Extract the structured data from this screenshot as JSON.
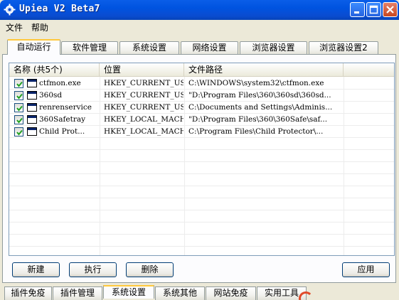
{
  "window": {
    "title": "Upiea V2 Beta7"
  },
  "menu": {
    "items": [
      "文件",
      "帮助"
    ]
  },
  "tabs_top": [
    "自动运行",
    "软件管理",
    "系统设置",
    "网络设置",
    "浏览器设置",
    "浏览器设置2"
  ],
  "list": {
    "columns": [
      "名称 (共5个)",
      "位置",
      "文件路径"
    ],
    "rows": [
      {
        "checked": true,
        "name": "ctfmon.exe",
        "location": "HKEY_CURRENT_USER",
        "path": "C:\\WINDOWS\\system32\\ctfmon.exe"
      },
      {
        "checked": true,
        "name": "360sd",
        "location": "HKEY_CURRENT_USER",
        "path": "\"D:\\Program Files\\360\\360sd\\360sd..."
      },
      {
        "checked": true,
        "name": "renrenservice",
        "location": "HKEY_CURRENT_USER",
        "path": "C:\\Documents and Settings\\Adminis..."
      },
      {
        "checked": true,
        "name": "360Safetray",
        "location": "HKEY_LOCAL_MACHINE",
        "path": "\"D:\\Program Files\\360\\360Safe\\saf..."
      },
      {
        "checked": true,
        "name": "Child Prot...",
        "location": "HKEY_LOCAL_MACHINE",
        "path": "C:\\Program Files\\Child Protector\\..."
      }
    ]
  },
  "buttons": {
    "new": "新建",
    "run": "执行",
    "delete": "删除",
    "apply": "应用"
  },
  "tabs_bottom": [
    "插件免疫",
    "插件管理",
    "系统设置",
    "系统其他",
    "网站免疫",
    "实用工具"
  ],
  "colors": {
    "titlebar": "#0054E3",
    "tab_highlight": "#FFC83C",
    "check": "#21A121"
  }
}
